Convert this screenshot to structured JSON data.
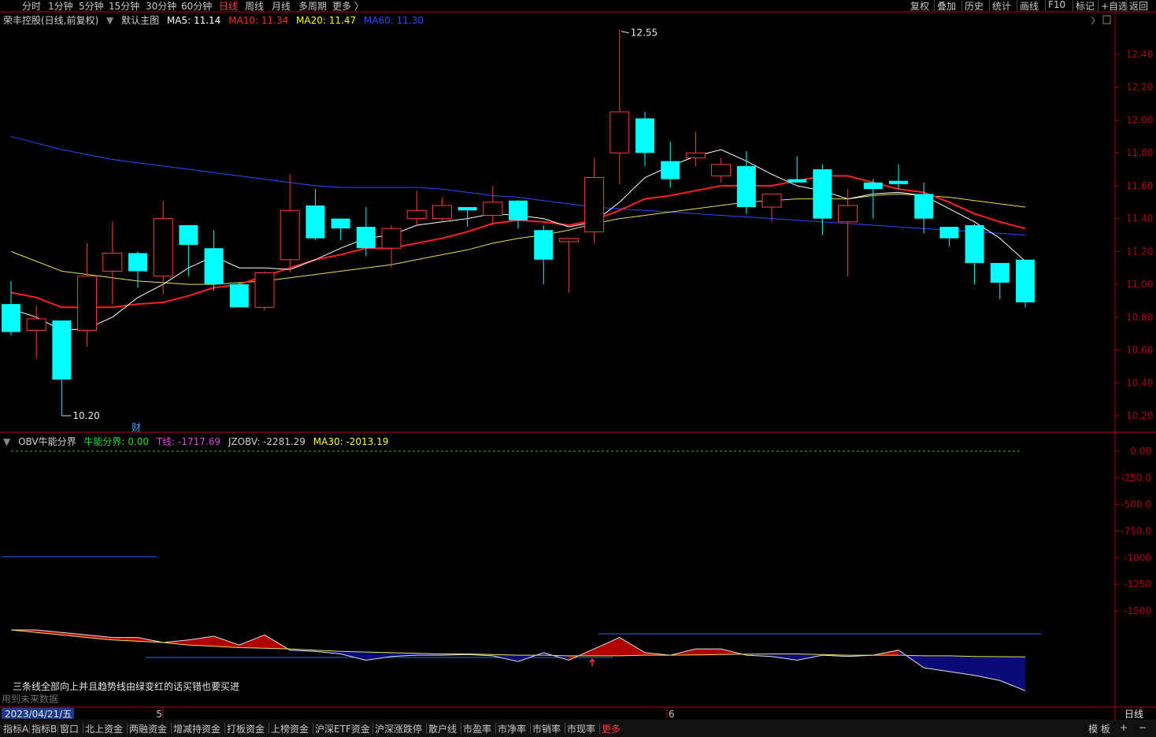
{
  "topbar": {
    "left_tabs": [
      "分时",
      "1分钟",
      "5分钟",
      "15分钟",
      "30分钟",
      "60分钟",
      "日线",
      "周线",
      "月线",
      "多周期",
      "更多 〉"
    ],
    "active_tab": "日线",
    "right_tabs": [
      "复权",
      "叠加",
      "历史",
      "统计",
      "画线",
      "F10",
      "标记",
      "+自选",
      "返回"
    ]
  },
  "main": {
    "title": "荣丰控股(日线,前复权)",
    "main_chart_label": "默认主图",
    "ma": [
      {
        "label": "MA5: 11.14",
        "color": "#ffffff"
      },
      {
        "label": "MA10: 11.34",
        "color": "#ff2a2a"
      },
      {
        "label": "MA20: 11.47",
        "color": "#ffff00"
      },
      {
        "label": "MA60: 11.30",
        "color": "#2b4bff"
      }
    ],
    "high_label": "12.55",
    "low_label": "10.20",
    "marker": "财",
    "y_ticks": [
      "12.40",
      "12.20",
      "12.00",
      "11.80",
      "11.60",
      "11.40",
      "11.20",
      "11.00",
      "10.80",
      "10.60",
      "10.40",
      "10.20"
    ]
  },
  "sub": {
    "indicator_name": "OBV牛能分界",
    "values": [
      {
        "label": "牛能分界: 0.00",
        "color": "#20e020"
      },
      {
        "label": "T线: -1717.69",
        "color": "#e040e0"
      },
      {
        "label": "JZOBV: -2281.29",
        "color": "#d0d0d0"
      },
      {
        "label": "MA30: -2013.19",
        "color": "#ffff40"
      }
    ],
    "y_ticks": [
      "0.00",
      "-250.0",
      "-500.0",
      "-750.0",
      "-1000",
      "-1250",
      "-1500"
    ],
    "note": "三条线全部向上并且趋势线由绿变红的话买错也要买进",
    "note2": "用到未来数据"
  },
  "xaxis": {
    "date_label": "2023/04/21/五",
    "month_labels": [
      "5",
      "6"
    ],
    "period_label": "日线"
  },
  "bottombar": {
    "tabs": [
      "指标A",
      "指标B",
      "窗口",
      "北上资金",
      "两融资金",
      "增减持资金",
      "打板资金",
      "上榜资金",
      "沪深ETF资金",
      "沪深涨跌停",
      "散户线",
      "市盈率",
      "市净率",
      "市销率",
      "市现率",
      "更多"
    ],
    "active_tab": "更多",
    "right": [
      "模 板",
      "+",
      "−"
    ]
  },
  "colors": {
    "up": "#ff3c3c",
    "down": "#00ffff",
    "axis": "#b0001e"
  },
  "chart_data": {
    "type": "candlestick",
    "title": "荣丰控股(日线,前复权)",
    "ylim": [
      10.15,
      12.6
    ],
    "candles": [
      {
        "o": 10.88,
        "h": 11.02,
        "l": 10.69,
        "c": 10.71
      },
      {
        "o": 10.72,
        "h": 10.87,
        "l": 10.55,
        "c": 10.79
      },
      {
        "o": 10.78,
        "h": 10.78,
        "l": 10.2,
        "c": 10.42
      },
      {
        "o": 10.72,
        "h": 11.25,
        "l": 10.62,
        "c": 11.05
      },
      {
        "o": 11.08,
        "h": 11.38,
        "l": 10.88,
        "c": 11.19
      },
      {
        "o": 11.19,
        "h": 11.2,
        "l": 10.98,
        "c": 11.08
      },
      {
        "o": 11.05,
        "h": 11.51,
        "l": 10.94,
        "c": 11.4
      },
      {
        "o": 11.36,
        "h": 11.36,
        "l": 11.05,
        "c": 11.24
      },
      {
        "o": 11.22,
        "h": 11.33,
        "l": 10.96,
        "c": 11.0
      },
      {
        "o": 11.0,
        "h": 11.01,
        "l": 10.86,
        "c": 10.86
      },
      {
        "o": 10.86,
        "h": 11.08,
        "l": 10.84,
        "c": 11.07
      },
      {
        "o": 11.15,
        "h": 11.67,
        "l": 11.07,
        "c": 11.45
      },
      {
        "o": 11.48,
        "h": 11.58,
        "l": 11.27,
        "c": 11.28
      },
      {
        "o": 11.4,
        "h": 11.4,
        "l": 11.27,
        "c": 11.34
      },
      {
        "o": 11.35,
        "h": 11.47,
        "l": 11.17,
        "c": 11.22
      },
      {
        "o": 11.22,
        "h": 11.36,
        "l": 11.1,
        "c": 11.34
      },
      {
        "o": 11.4,
        "h": 11.57,
        "l": 11.36,
        "c": 11.45
      },
      {
        "o": 11.4,
        "h": 11.53,
        "l": 11.38,
        "c": 11.48
      },
      {
        "o": 11.47,
        "h": 11.47,
        "l": 11.35,
        "c": 11.45
      },
      {
        "o": 11.42,
        "h": 11.6,
        "l": 11.36,
        "c": 11.5
      },
      {
        "o": 11.51,
        "h": 11.51,
        "l": 11.34,
        "c": 11.39
      },
      {
        "o": 11.33,
        "h": 11.36,
        "l": 11.0,
        "c": 11.15
      },
      {
        "o": 11.26,
        "h": 11.28,
        "l": 10.95,
        "c": 11.28
      },
      {
        "o": 11.32,
        "h": 11.77,
        "l": 11.25,
        "c": 11.65
      },
      {
        "o": 11.8,
        "h": 12.55,
        "l": 11.61,
        "c": 12.05
      },
      {
        "o": 12.01,
        "h": 12.05,
        "l": 11.72,
        "c": 11.8
      },
      {
        "o": 11.75,
        "h": 11.87,
        "l": 11.59,
        "c": 11.64
      },
      {
        "o": 11.77,
        "h": 11.93,
        "l": 11.72,
        "c": 11.8
      },
      {
        "o": 11.66,
        "h": 11.77,
        "l": 11.62,
        "c": 11.73
      },
      {
        "o": 11.72,
        "h": 11.81,
        "l": 11.43,
        "c": 11.47
      },
      {
        "o": 11.47,
        "h": 11.55,
        "l": 11.38,
        "c": 11.55
      },
      {
        "o": 11.64,
        "h": 11.78,
        "l": 11.62,
        "c": 11.62
      },
      {
        "o": 11.7,
        "h": 11.73,
        "l": 11.3,
        "c": 11.4
      },
      {
        "o": 11.38,
        "h": 11.58,
        "l": 11.05,
        "c": 11.48
      },
      {
        "o": 11.62,
        "h": 11.64,
        "l": 11.4,
        "c": 11.58
      },
      {
        "o": 11.63,
        "h": 11.73,
        "l": 11.58,
        "c": 11.61
      },
      {
        "o": 11.55,
        "h": 11.62,
        "l": 11.31,
        "c": 11.4
      },
      {
        "o": 11.35,
        "h": 11.35,
        "l": 11.23,
        "c": 11.28
      },
      {
        "o": 11.36,
        "h": 11.37,
        "l": 11.0,
        "c": 11.13
      },
      {
        "o": 11.13,
        "h": 11.13,
        "l": 10.91,
        "c": 11.01
      },
      {
        "o": 11.15,
        "h": 11.15,
        "l": 10.86,
        "c": 10.89
      }
    ],
    "ma5": [
      10.85,
      10.8,
      10.72,
      10.73,
      10.8,
      10.92,
      11.0,
      11.1,
      11.17,
      11.1,
      11.1,
      11.09,
      11.15,
      11.22,
      11.28,
      11.3,
      11.36,
      11.38,
      11.4,
      11.43,
      11.42,
      11.4,
      11.35,
      11.38,
      11.5,
      11.65,
      11.72,
      11.78,
      11.82,
      11.75,
      11.67,
      11.6,
      11.57,
      11.52,
      11.55,
      11.56,
      11.54,
      11.46,
      11.38,
      11.28,
      11.14
    ],
    "ma10": [
      10.95,
      10.92,
      10.86,
      10.86,
      10.86,
      10.88,
      10.89,
      10.93,
      10.98,
      11.0,
      11.05,
      11.1,
      11.15,
      11.18,
      11.22,
      11.22,
      11.25,
      11.28,
      11.32,
      11.37,
      11.39,
      11.38,
      11.36,
      11.39,
      11.45,
      11.52,
      11.54,
      11.57,
      11.6,
      11.6,
      11.6,
      11.63,
      11.66,
      11.66,
      11.62,
      11.58,
      11.56,
      11.5,
      11.43,
      11.38,
      11.34
    ],
    "ma20": [
      11.2,
      11.14,
      11.08,
      11.06,
      11.04,
      11.02,
      11.01,
      11.0,
      11.0,
      11.01,
      11.02,
      11.04,
      11.06,
      11.08,
      11.1,
      11.12,
      11.15,
      11.18,
      11.21,
      11.25,
      11.28,
      11.3,
      11.33,
      11.37,
      11.4,
      11.42,
      11.44,
      11.46,
      11.48,
      11.5,
      11.51,
      11.52,
      11.52,
      11.52,
      11.54,
      11.55,
      11.54,
      11.53,
      11.51,
      11.49,
      11.47
    ],
    "ma60": [
      11.9,
      11.86,
      11.82,
      11.79,
      11.76,
      11.74,
      11.72,
      11.7,
      11.68,
      11.66,
      11.64,
      11.62,
      11.6,
      11.59,
      11.59,
      11.59,
      11.59,
      11.58,
      11.56,
      11.54,
      11.53,
      11.51,
      11.49,
      11.47,
      11.46,
      11.45,
      11.44,
      11.43,
      11.42,
      11.41,
      11.4,
      11.39,
      11.38,
      11.37,
      11.36,
      11.35,
      11.34,
      11.33,
      11.32,
      11.31,
      11.3
    ],
    "obv_jzobv": [
      -1800,
      -1800,
      -1820,
      -1840,
      -1860,
      -1860,
      -1900,
      -1880,
      -1850,
      -1920,
      -1840,
      -1960,
      -1970,
      -1990,
      -2040,
      -2010,
      -2000,
      -2000,
      -1995,
      -2005,
      -2050,
      -1980,
      -2040,
      -1950,
      -1860,
      -1980,
      -2000,
      -1950,
      -1950,
      -2000,
      -2010,
      -2040,
      -2000,
      -2010,
      -2000,
      -1960,
      -2100,
      -2130,
      -2160,
      -2200,
      -2281.29
    ],
    "obv_ma30": [
      -1800,
      -1820,
      -1840,
      -1860,
      -1880,
      -1890,
      -1900,
      -1920,
      -1930,
      -1940,
      -1945,
      -1950,
      -1960,
      -1970,
      -1975,
      -1980,
      -1985,
      -1990,
      -1990,
      -1995,
      -2000,
      -2000,
      -2005,
      -2005,
      -2005,
      -2000,
      -2000,
      -1998,
      -1995,
      -1992,
      -1990,
      -1990,
      -1995,
      -2000,
      -2000,
      -2000,
      -2005,
      -2005,
      -2010,
      -2012,
      -2013.19
    ]
  }
}
